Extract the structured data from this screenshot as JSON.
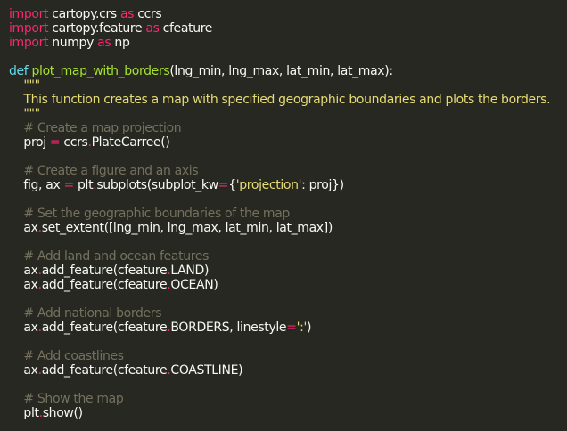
{
  "editor": {
    "lines": [
      [
        {
          "t": "import",
          "c": "kw"
        },
        {
          "t": " cartopy.crs ",
          "c": "pl"
        },
        {
          "t": "as",
          "c": "kw"
        },
        {
          "t": " ccrs",
          "c": "pl"
        }
      ],
      [
        {
          "t": "import",
          "c": "kw"
        },
        {
          "t": " cartopy.feature ",
          "c": "pl"
        },
        {
          "t": "as",
          "c": "kw"
        },
        {
          "t": " cfeature",
          "c": "pl"
        }
      ],
      [
        {
          "t": "import",
          "c": "kw"
        },
        {
          "t": " numpy ",
          "c": "pl"
        },
        {
          "t": "as",
          "c": "kw"
        },
        {
          "t": " np",
          "c": "pl"
        }
      ],
      [],
      [
        {
          "t": "def",
          "c": "def"
        },
        {
          "t": " ",
          "c": "pl"
        },
        {
          "t": "plot_map_with_borders",
          "c": "fn"
        },
        {
          "t": "(lng_min, lng_max, lat_min, lat_max):",
          "c": "pl"
        }
      ],
      [
        {
          "t": "    \"\"\"",
          "c": "str"
        }
      ],
      [
        {
          "t": "    This function creates a map with specified geographic boundaries and plots the borders.",
          "c": "str"
        }
      ],
      [
        {
          "t": "    \"\"\"",
          "c": "str"
        }
      ],
      [
        {
          "t": "    # Create a map projection",
          "c": "com"
        }
      ],
      [
        {
          "t": "    proj ",
          "c": "pl"
        },
        {
          "t": "=",
          "c": "op"
        },
        {
          "t": " ccrs",
          "c": "pl"
        },
        {
          "t": ".",
          "c": "op"
        },
        {
          "t": "PlateCarree()",
          "c": "pl"
        }
      ],
      [],
      [
        {
          "t": "    # Create a figure and an axis",
          "c": "com"
        }
      ],
      [
        {
          "t": "    fig, ax ",
          "c": "pl"
        },
        {
          "t": "=",
          "c": "op"
        },
        {
          "t": " plt",
          "c": "pl"
        },
        {
          "t": ".",
          "c": "op"
        },
        {
          "t": "subplots(subplot_kw",
          "c": "pl"
        },
        {
          "t": "=",
          "c": "op"
        },
        {
          "t": "{",
          "c": "pl"
        },
        {
          "t": "'projection'",
          "c": "str"
        },
        {
          "t": ": proj})",
          "c": "pl"
        }
      ],
      [],
      [
        {
          "t": "    # Set the geographic boundaries of the map",
          "c": "com"
        }
      ],
      [
        {
          "t": "    ax",
          "c": "pl"
        },
        {
          "t": ".",
          "c": "op"
        },
        {
          "t": "set_extent([lng_min, lng_max, lat_min, lat_max])",
          "c": "pl"
        }
      ],
      [],
      [
        {
          "t": "    # Add land and ocean features",
          "c": "com"
        }
      ],
      [
        {
          "t": "    ax",
          "c": "pl"
        },
        {
          "t": ".",
          "c": "op"
        },
        {
          "t": "add_feature(cfeature",
          "c": "pl"
        },
        {
          "t": ".",
          "c": "op"
        },
        {
          "t": "LAND)",
          "c": "pl"
        }
      ],
      [
        {
          "t": "    ax",
          "c": "pl"
        },
        {
          "t": ".",
          "c": "op"
        },
        {
          "t": "add_feature(cfeature",
          "c": "pl"
        },
        {
          "t": ".",
          "c": "op"
        },
        {
          "t": "OCEAN)",
          "c": "pl"
        }
      ],
      [],
      [
        {
          "t": "    # Add national borders",
          "c": "com"
        }
      ],
      [
        {
          "t": "    ax",
          "c": "pl"
        },
        {
          "t": ".",
          "c": "op"
        },
        {
          "t": "add_feature(cfeature",
          "c": "pl"
        },
        {
          "t": ".",
          "c": "op"
        },
        {
          "t": "BORDERS, linestyle",
          "c": "pl"
        },
        {
          "t": "=",
          "c": "op"
        },
        {
          "t": "':'",
          "c": "str"
        },
        {
          "t": ")",
          "c": "pl"
        }
      ],
      [],
      [
        {
          "t": "    # Add coastlines",
          "c": "com"
        }
      ],
      [
        {
          "t": "    ax",
          "c": "pl"
        },
        {
          "t": ".",
          "c": "op"
        },
        {
          "t": "add_feature(cfeature",
          "c": "pl"
        },
        {
          "t": ".",
          "c": "op"
        },
        {
          "t": "COASTLINE)",
          "c": "pl"
        }
      ],
      [],
      [
        {
          "t": "    # Show the map",
          "c": "com"
        }
      ],
      [
        {
          "t": "    plt",
          "c": "pl"
        },
        {
          "t": ".",
          "c": "op"
        },
        {
          "t": "show()",
          "c": "pl"
        }
      ]
    ]
  },
  "colors": {
    "background": "#272822",
    "keyword": "#f92672",
    "function": "#a6e22e",
    "string": "#e6db74",
    "comment": "#75715e",
    "def": "#66d9ef",
    "plain": "#f8f8f2"
  }
}
